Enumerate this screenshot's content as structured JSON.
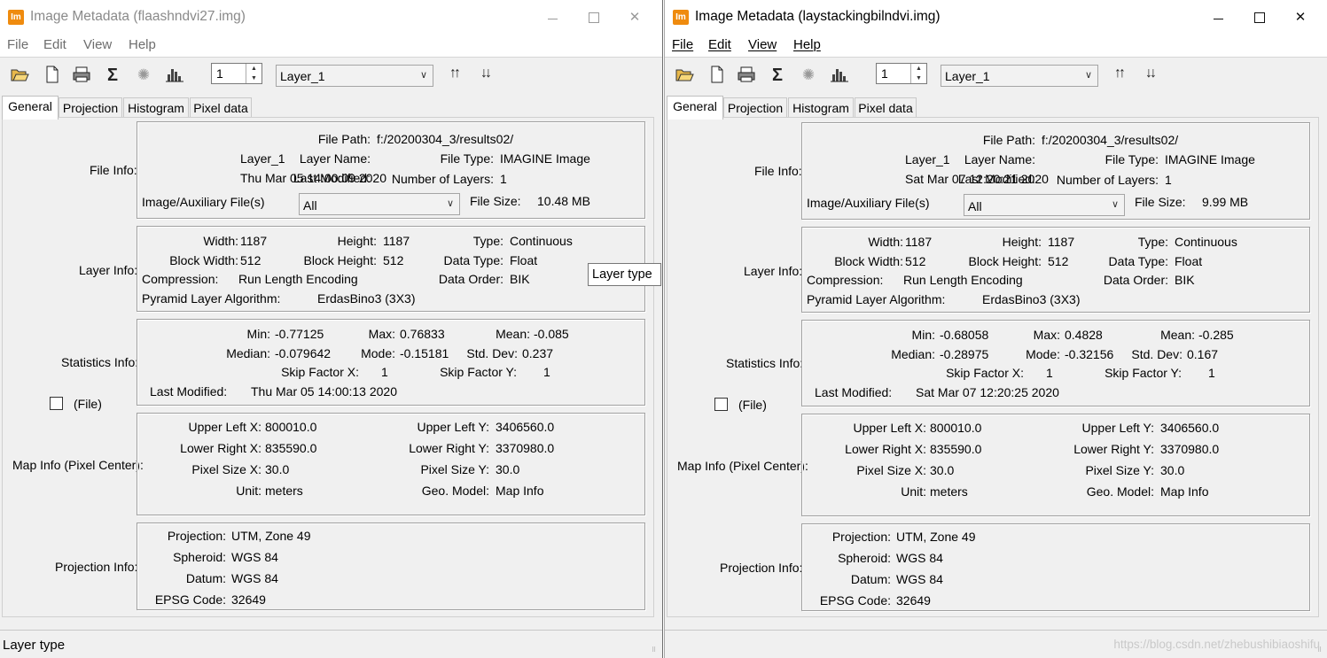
{
  "tooltip": "Layer type",
  "watermark": "https://blog.csdn.net/zhebushibiaoshifu",
  "windows": [
    {
      "title": "Image Metadata (flaashndvi27.img)",
      "app_icon": "Im",
      "controls": {
        "minimize": "minimize-icon",
        "maximize": "maximize-icon",
        "close": "✕"
      },
      "menu": [
        "File",
        "Edit",
        "View",
        "Help"
      ],
      "toolbar": {
        "layer_number": "1",
        "layer_select": "Layer_1"
      },
      "tabs": [
        "General",
        "Projection",
        "Histogram",
        "Pixel data"
      ],
      "active_tab": "General",
      "file_info": {
        "label": "File Info:",
        "file_path_label": "File Path:",
        "file_path": "f:/20200304_3/results02/",
        "layer_name_label": "Layer Name:",
        "layer_name": "Layer_1",
        "file_type_label": "File Type:",
        "file_type": "IMAGINE Image",
        "last_modified_label": "Last Modified:",
        "last_modified": "Thu Mar 05 14:00:09 2020",
        "num_layers_label": "Number of Layers:",
        "num_layers": "1",
        "aux_label": "Image/Auxiliary File(s)",
        "aux_value": "All",
        "file_size_label": "File Size:",
        "file_size": "10.48 MB"
      },
      "layer_info": {
        "label": "Layer Info:",
        "width_label": "Width:",
        "width": "1187",
        "height_label": "Height:",
        "height": "1187",
        "type_label": "Type:",
        "type": "Continuous",
        "block_width_label": "Block Width:",
        "block_width": "512",
        "block_height_label": "Block Height:",
        "block_height": "512",
        "data_type_label": "Data Type:",
        "data_type": "Float",
        "compression_label": "Compression:",
        "compression": "Run Length Encoding",
        "data_order_label": "Data Order:",
        "data_order": "BIK",
        "pyramid_label": "Pyramid Layer Algorithm:",
        "pyramid": "ErdasBino3 (3X3)"
      },
      "statistics_info": {
        "label": "Statistics Info:",
        "min_label": "Min:",
        "min": "-0.77125",
        "max_label": "Max:",
        "max": "0.76833",
        "mean_label": "Mean:",
        "mean": "-0.085",
        "median_label": "Median:",
        "median": "-0.079642",
        "mode_label": "Mode:",
        "mode": "-0.15181",
        "std_label": "Std. Dev:",
        "std": "0.237",
        "skip_x_label": "Skip Factor X:",
        "skip_x": "1",
        "skip_y_label": "Skip Factor Y:",
        "skip_y": "1",
        "last_modified_label": "Last Modified:",
        "last_modified": "Thu Mar 05 14:00:13 2020",
        "file_checkbox_label": "(File)"
      },
      "map_info": {
        "label": "Map Info (Pixel Center):",
        "ulx_label": "Upper Left X:",
        "ulx": "800010.0",
        "uly_label": "Upper Left Y:",
        "uly": "3406560.0",
        "lrx_label": "Lower Right X:",
        "lrx": "835590.0",
        "lry_label": "Lower Right Y:",
        "lry": "3370980.0",
        "psx_label": "Pixel Size X:",
        "psx": "30.0",
        "psy_label": "Pixel Size Y:",
        "psy": "30.0",
        "unit_label": "Unit:",
        "unit": "meters",
        "geo_label": "Geo. Model:",
        "geo": "Map Info"
      },
      "projection_info": {
        "label": "Projection Info:",
        "projection_label": "Projection:",
        "projection": "UTM, Zone 49",
        "spheroid_label": "Spheroid:",
        "spheroid": "WGS 84",
        "datum_label": "Datum:",
        "datum": "WGS 84",
        "epsg_label": "EPSG Code:",
        "epsg": "32649"
      },
      "status": "Layer type"
    },
    {
      "title": "Image Metadata (laystackingbilndvi.img)",
      "app_icon": "Im",
      "controls": {
        "minimize": "minimize-icon",
        "maximize": "maximize-icon",
        "close": "✕"
      },
      "menu": [
        "File",
        "Edit",
        "View",
        "Help"
      ],
      "toolbar": {
        "layer_number": "1",
        "layer_select": "Layer_1"
      },
      "tabs": [
        "General",
        "Projection",
        "Histogram",
        "Pixel data"
      ],
      "active_tab": "General",
      "file_info": {
        "label": "File Info:",
        "file_path_label": "File Path:",
        "file_path": "f:/20200304_3/results02/",
        "layer_name_label": "Layer Name:",
        "layer_name": "Layer_1",
        "file_type_label": "File Type:",
        "file_type": "IMAGINE Image",
        "last_modified_label": "Last Modified:",
        "last_modified": "Sat Mar 07 12:20:21 2020",
        "num_layers_label": "Number of Layers:",
        "num_layers": "1",
        "aux_label": "Image/Auxiliary File(s)",
        "aux_value": "All",
        "file_size_label": "File Size:",
        "file_size": "9.99 MB"
      },
      "layer_info": {
        "label": "Layer Info:",
        "width_label": "Width:",
        "width": "1187",
        "height_label": "Height:",
        "height": "1187",
        "type_label": "Type:",
        "type": "Continuous",
        "block_width_label": "Block Width:",
        "block_width": "512",
        "block_height_label": "Block Height:",
        "block_height": "512",
        "data_type_label": "Data Type:",
        "data_type": "Float",
        "compression_label": "Compression:",
        "compression": "Run Length Encoding",
        "data_order_label": "Data Order:",
        "data_order": "BIK",
        "pyramid_label": "Pyramid Layer Algorithm:",
        "pyramid": "ErdasBino3 (3X3)"
      },
      "statistics_info": {
        "label": "Statistics Info:",
        "min_label": "Min:",
        "min": "-0.68058",
        "max_label": "Max:",
        "max": "0.4828",
        "mean_label": "Mean:",
        "mean": "-0.285",
        "median_label": "Median:",
        "median": "-0.28975",
        "mode_label": "Mode:",
        "mode": "-0.32156",
        "std_label": "Std. Dev:",
        "std": "0.167",
        "skip_x_label": "Skip Factor X:",
        "skip_x": "1",
        "skip_y_label": "Skip Factor Y:",
        "skip_y": "1",
        "last_modified_label": "Last Modified:",
        "last_modified": "Sat Mar 07 12:20:25 2020",
        "file_checkbox_label": "(File)"
      },
      "map_info": {
        "label": "Map Info (Pixel Center):",
        "ulx_label": "Upper Left X:",
        "ulx": "800010.0",
        "uly_label": "Upper Left Y:",
        "uly": "3406560.0",
        "lrx_label": "Lower Right X:",
        "lrx": "835590.0",
        "lry_label": "Lower Right Y:",
        "lry": "3370980.0",
        "psx_label": "Pixel Size X:",
        "psx": "30.0",
        "psy_label": "Pixel Size Y:",
        "psy": "30.0",
        "unit_label": "Unit:",
        "unit": "meters",
        "geo_label": "Geo. Model:",
        "geo": "Map Info"
      },
      "projection_info": {
        "label": "Projection Info:",
        "projection_label": "Projection:",
        "projection": "UTM, Zone 49",
        "spheroid_label": "Spheroid:",
        "spheroid": "WGS 84",
        "datum_label": "Datum:",
        "datum": "WGS 84",
        "epsg_label": "EPSG Code:",
        "epsg": "32649"
      },
      "status": ""
    }
  ]
}
